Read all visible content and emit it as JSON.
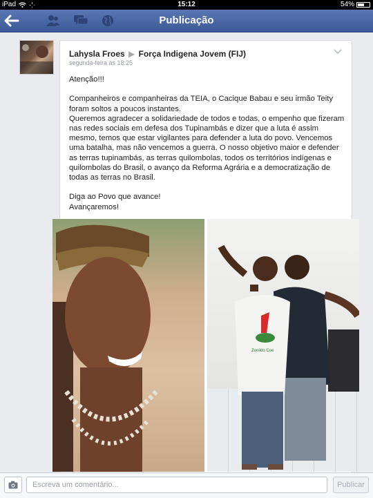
{
  "status_bar": {
    "device": "iPad",
    "time": "15:12",
    "battery": "54%"
  },
  "nav": {
    "title": "Publicação",
    "icons": [
      "back-arrow-icon",
      "friends-icon",
      "messages-icon",
      "globe-icon"
    ]
  },
  "post": {
    "author": "Lahysla Froes",
    "target": "Força Indigena Jovem (FIJ)",
    "timestamp": "segunda-feira às 18:25",
    "paragraphs": [
      "Atenção!!!",
      "Companheiros e companheiras da TEIA, o Cacique Babau e seu irmão Teity foram soltos a poucos instantes.\nQueremos agradecer a solidariedade de todos e todas, o empenho que fizeram nas redes sociais em defesa dos Tupinambás e dizer que a luta é assim mesmo, temos que estar vigilantes para defender a luta do povo. Vencemos uma batalha, mas não vencemos a guerra. O nosso objetivo maior e defender as terras tupinambás, as terras quilombolas, todos os territórios indígenas e quilombolas do Brasil, o avanço da Reforma Agrária e a democratização de todas as terras no Brasil.",
      "Diga ao Povo que avance!\nAvançaremos!"
    ],
    "shirt_text": "Zonildo Coe"
  },
  "composer": {
    "placeholder": "Escreva um comentário...",
    "submit_label": "Publicar"
  }
}
